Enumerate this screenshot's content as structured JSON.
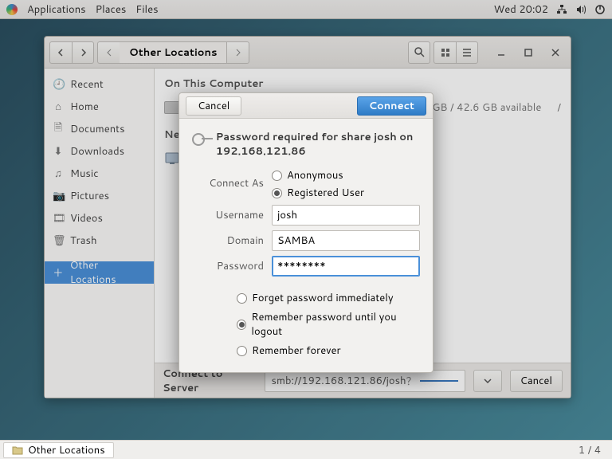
{
  "menubar": {
    "applications": "Applications",
    "places": "Places",
    "files": "Files",
    "clock": "Wed 20:02"
  },
  "headerbar": {
    "location": "Other Locations"
  },
  "sidebar": {
    "items": [
      {
        "icon": "🕘",
        "label": "Recent"
      },
      {
        "icon": "⌂",
        "label": "Home"
      },
      {
        "icon": "🗎",
        "label": "Documents"
      },
      {
        "icon": "⬇",
        "label": "Downloads"
      },
      {
        "icon": "♫",
        "label": "Music"
      },
      {
        "icon": "📷",
        "label": "Pictures"
      },
      {
        "icon": "🎞",
        "label": "Videos"
      },
      {
        "icon": "🗑",
        "label": "Trash"
      },
      {
        "icon": "＋",
        "label": "Other Locations"
      }
    ]
  },
  "main": {
    "on_this_computer": "On This Computer",
    "drive_free": "GB / 42.6 GB available",
    "sep": "/",
    "networks": "Netw",
    "connect_to_server": "Connect to Server",
    "server_address": "smb://192.168.121.86/josh",
    "cancel": "Cancel"
  },
  "dialog": {
    "cancel": "Cancel",
    "connect": "Connect",
    "title": "Password required for share josh on 192.168.121.86",
    "connect_as": "Connect As",
    "anonymous": "Anonymous",
    "registered": "Registered User",
    "username_label": "Username",
    "username_value": "josh",
    "domain_label": "Domain",
    "domain_value": "SAMBA",
    "password_label": "Password",
    "password_value": "********",
    "forget": "Forget password immediately",
    "until_logout": "Remember password until you logout",
    "forever": "Remember forever"
  },
  "taskbar": {
    "item": "Other Locations",
    "workspace": "1 / 4"
  }
}
